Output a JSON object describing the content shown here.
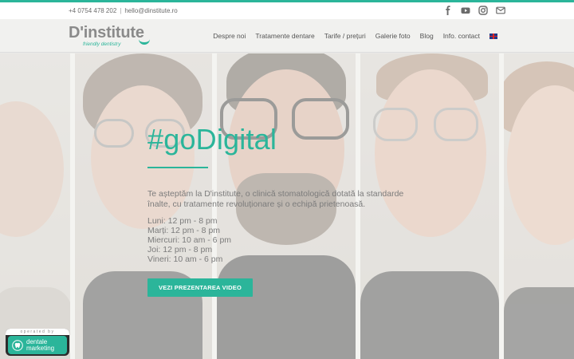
{
  "topbar": {
    "phone": "+4 0754 478 202",
    "separator": "|",
    "email": "hello@dinstitute.ro",
    "social_icons": [
      "facebook-icon",
      "youtube-icon",
      "instagram-icon",
      "mail-icon"
    ]
  },
  "header": {
    "logo_text": "D'institute",
    "logo_tagline": "friendly dentistry",
    "nav": [
      {
        "label": "Despre noi"
      },
      {
        "label": "Tratamente dentare"
      },
      {
        "label": "Tarife / prețuri"
      },
      {
        "label": "Galerie foto"
      },
      {
        "label": "Blog"
      },
      {
        "label": "Info. contact"
      }
    ],
    "language_icon": "uk-flag-icon"
  },
  "hero": {
    "headline": "#goDigital",
    "intro": "Te așteptăm la D'institute, o clinică stomatologică dotată la standarde înalte, cu tratamente revoluționare și o echipă prietenoasă.",
    "hours": [
      "Luni: 12 pm - 8 pm",
      "Marți: 12 pm - 8 pm",
      "Miercuri: 10 am - 6 pm",
      "Joi: 12 pm - 8 pm",
      "Vineri: 10 am - 6 pm"
    ],
    "cta_label": "VEZI PREZENTAREA VIDEO"
  },
  "badge": {
    "operated_by": "operated by",
    "line1": "dentale",
    "line2": "marketing"
  },
  "colors": {
    "accent": "#2bb59a",
    "text_muted": "#7c7c7c",
    "header_bg": "#f1f1ef"
  }
}
